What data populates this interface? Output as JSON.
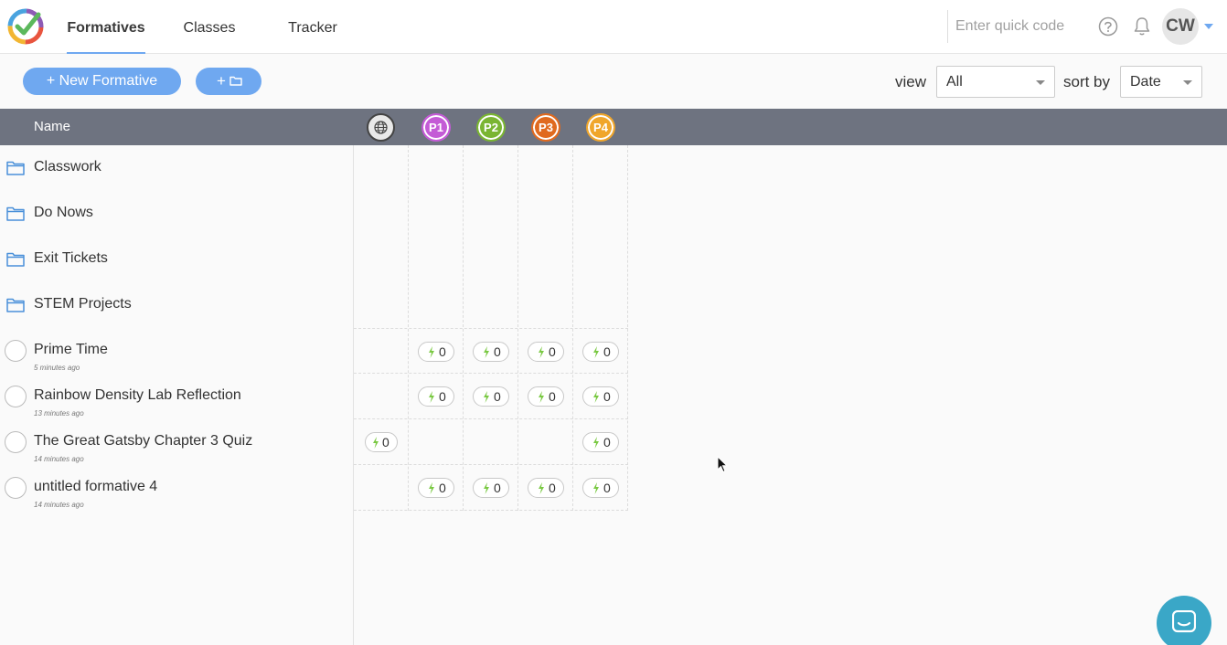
{
  "nav": {
    "tabs": [
      {
        "label": "Formatives",
        "active": true
      },
      {
        "label": "Classes",
        "active": false
      },
      {
        "label": "Tracker",
        "active": false
      }
    ],
    "quickcode_placeholder": "Enter quick code",
    "avatar_initials": "CW"
  },
  "toolbar": {
    "new_formative_label": "+ New Formative",
    "new_folder_label": "+",
    "view_label": "view",
    "view_value": "All",
    "sort_label": "sort by",
    "sort_value": "Date"
  },
  "table": {
    "name_header": "Name",
    "periods": [
      {
        "label": "P1",
        "color": "#c45bd6"
      },
      {
        "label": "P2",
        "color": "#7ab532"
      },
      {
        "label": "P3",
        "color": "#e06a1f"
      },
      {
        "label": "P4",
        "color": "#f0a62b"
      }
    ],
    "folders": [
      "Classwork",
      "Do Nows",
      "Exit Tickets",
      "STEM Projects"
    ],
    "formatives": [
      {
        "title": "Prime Time",
        "time": "5 minutes ago",
        "global": null,
        "counts": [
          "0",
          "0",
          "0",
          "0"
        ]
      },
      {
        "title": "Rainbow Density Lab Reflection",
        "time": "13 minutes ago",
        "global": null,
        "counts": [
          "0",
          "0",
          "0",
          "0"
        ]
      },
      {
        "title": "The Great Gatsby Chapter 3 Quiz",
        "time": "14 minutes ago",
        "global": "0",
        "counts": [
          null,
          null,
          null,
          "0"
        ]
      },
      {
        "title": "untitled formative 4",
        "time": "14 minutes ago",
        "global": null,
        "counts": [
          "0",
          "0",
          "0",
          "0"
        ]
      }
    ]
  },
  "colors": {
    "accent": "#6fa8f0",
    "header_bg": "#6e7380",
    "bolt": "#7ac943"
  }
}
